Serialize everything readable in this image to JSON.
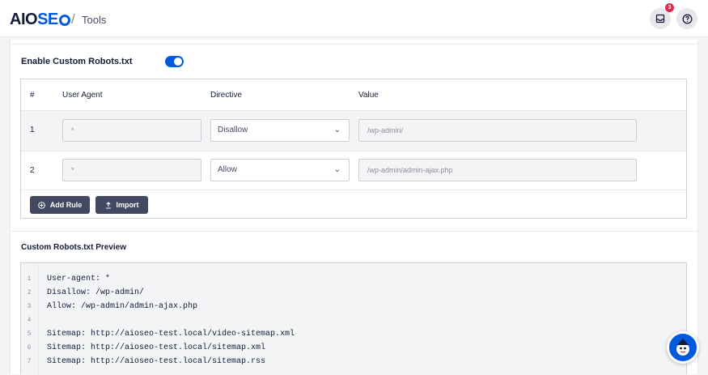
{
  "header": {
    "logo_prefix": "AIO",
    "logo_suffix": "SE",
    "breadcrumb_sep": "/",
    "breadcrumb": "Tools",
    "notification_count": "3"
  },
  "robots": {
    "enable_label": "Enable Custom Robots.txt",
    "enabled": true,
    "columns": {
      "num": "#",
      "user_agent": "User Agent",
      "directive": "Directive",
      "value": "Value"
    },
    "rules": [
      {
        "num": "1",
        "user_agent_placeholder": "*",
        "directive": "Disallow",
        "value": "/wp-admin/"
      },
      {
        "num": "2",
        "user_agent_placeholder": "*",
        "directive": "Allow",
        "value": "/wp-admin/admin-ajax.php"
      }
    ],
    "add_rule_label": "Add Rule",
    "import_label": "Import"
  },
  "preview": {
    "title": "Custom Robots.txt Preview",
    "lines": [
      {
        "n": "1",
        "text": "User-agent: *"
      },
      {
        "n": "2",
        "text": "Disallow: /wp-admin/"
      },
      {
        "n": "3",
        "text": "Allow: /wp-admin/admin-ajax.php"
      },
      {
        "n": "4",
        "text": ""
      },
      {
        "n": "5",
        "text": "Sitemap: http://aioseo-test.local/video-sitemap.xml"
      },
      {
        "n": "6",
        "text": "Sitemap: http://aioseo-test.local/sitemap.xml"
      },
      {
        "n": "7",
        "text": "Sitemap: http://aioseo-test.local/sitemap.rss"
      }
    ]
  },
  "colors": {
    "accent": "#005ae0",
    "button": "#434960",
    "badge": "#df2a4a"
  }
}
